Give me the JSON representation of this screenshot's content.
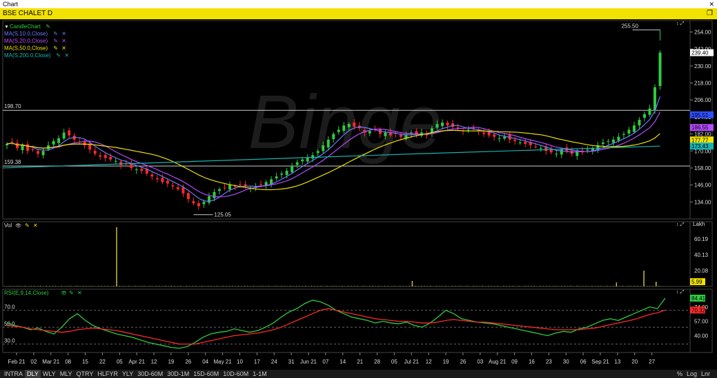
{
  "window": {
    "title": "Chart",
    "close_icon": "close-icon"
  },
  "symbol": {
    "label": "BSE CHALET D",
    "restore_icon": "restore-icon"
  },
  "legend": [
    {
      "label": "CandleChart",
      "color": "#2ecc40"
    },
    {
      "label": "MA(S,10.0,Close)",
      "color": "#6b7bff"
    },
    {
      "label": "MA(S,20.0,Close)",
      "color": "#b44cff"
    },
    {
      "label": "MA(S,50.0,Close)",
      "color": "#f2e200"
    },
    {
      "label": "MA(S,200.0,Close)",
      "color": "#17b3b3"
    }
  ],
  "vol_legend": "Vol",
  "rsi_legend": "RSI(E,9,14,Close)",
  "price_axis": {
    "ticks": [
      "254.00",
      "242.00",
      "230.00",
      "218.00",
      "206.00",
      "194.00",
      "182.00",
      "170.00",
      "158.00",
      "146.00",
      "134.00"
    ]
  },
  "vol_axis": {
    "unit": "Lakh",
    "ticks": [
      "60.19",
      "40.13",
      "20.08"
    ],
    "last": "5.99"
  },
  "rsi_axis": {
    "ticks": [
      "74.00",
      "57.00",
      "40.00"
    ],
    "left_ticks": [
      "70.0",
      "50.0",
      "30.0"
    ],
    "rsi_value": "84.41",
    "signal_value": "70.32"
  },
  "price_badges": [
    "239.40",
    "195.51",
    "186.55",
    "177.77",
    "173.43"
  ],
  "level_labels": {
    "upper": "198.70",
    "lower": "159.38"
  },
  "annotations": {
    "high": "255.50",
    "low": "125.05"
  },
  "watermark": "Binge",
  "xaxis": [
    {
      "label": "Feb 21"
    },
    {
      "label": "02"
    },
    {
      "label": "Mar 21"
    },
    {
      "label": "08"
    },
    {
      "label": "15"
    },
    {
      "label": "22"
    },
    {
      "label": "05"
    },
    {
      "label": "Apr 21"
    },
    {
      "label": "12"
    },
    {
      "label": "19"
    },
    {
      "label": "26"
    },
    {
      "label": "04"
    },
    {
      "label": "May 21"
    },
    {
      "label": "10"
    },
    {
      "label": "17"
    },
    {
      "label": "24"
    },
    {
      "label": "31"
    },
    {
      "label": "Jun 21"
    },
    {
      "label": "07"
    },
    {
      "label": "14"
    },
    {
      "label": "21"
    },
    {
      "label": "28"
    },
    {
      "label": "05"
    },
    {
      "label": "Jul 21"
    },
    {
      "label": "12"
    },
    {
      "label": "19"
    },
    {
      "label": "26"
    },
    {
      "label": "03"
    },
    {
      "label": "Aug 21"
    },
    {
      "label": "09"
    },
    {
      "label": "16"
    },
    {
      "label": "23"
    },
    {
      "label": "30"
    },
    {
      "label": "06"
    },
    {
      "label": "Sep 21"
    },
    {
      "label": "13"
    },
    {
      "label": "20"
    },
    {
      "label": "27"
    }
  ],
  "bottom_tabs": [
    "INTRA",
    "DLY",
    "WLY",
    "MLY",
    "QTRY",
    "HLFYR",
    "YLY",
    "30D-60M",
    "30D-1M",
    "15D-60M",
    "10D-60M",
    "1-1M"
  ],
  "bottom_selected": "DLY",
  "bottom_right": [
    "%",
    "Log",
    "Lnr"
  ],
  "chart_data": [
    {
      "type": "candlestick",
      "title": "BSE CHALET D",
      "ylim": [
        122,
        262
      ],
      "horizontal_lines": [
        198.7,
        159.38
      ],
      "closes": [
        175,
        176,
        172,
        174,
        170,
        171,
        168,
        170,
        174,
        177,
        179,
        183,
        181,
        178,
        176,
        174,
        171,
        168,
        166,
        165,
        164,
        163,
        160,
        161,
        158,
        157,
        156,
        154,
        152,
        150,
        148,
        147,
        145,
        143,
        140,
        136,
        133,
        131,
        134,
        138,
        141,
        143,
        144,
        146,
        145,
        146,
        145,
        144,
        145,
        146,
        148,
        150,
        152,
        154,
        156,
        159,
        162,
        164,
        165,
        167,
        170,
        174,
        178,
        182,
        185,
        188,
        189,
        187,
        186,
        183,
        184,
        185,
        182,
        183,
        181,
        182,
        180,
        181,
        183,
        182,
        183,
        181,
        186,
        189,
        190,
        188,
        187,
        186,
        184,
        185,
        186,
        184,
        182,
        181,
        180,
        179,
        180,
        178,
        177,
        176,
        175,
        174,
        173,
        172,
        170,
        169,
        168,
        171,
        170,
        168,
        170,
        169,
        171,
        172,
        174,
        176,
        177,
        178,
        180,
        182,
        185,
        188,
        192,
        196,
        200,
        215,
        239.4
      ],
      "highs_marked": {
        "high": 255.5,
        "low": 125.05
      },
      "series": [
        {
          "name": "MA(S,10.0,Close)",
          "last": 195.51
        },
        {
          "name": "MA(S,20.0,Close)",
          "last": 186.55
        },
        {
          "name": "MA(S,50.0,Close)",
          "last": 177.77
        },
        {
          "name": "MA(S,200.0,Close)",
          "last": 173.43
        }
      ]
    },
    {
      "type": "bar",
      "title": "Vol",
      "ylabel": "Lakh",
      "spikes": [
        {
          "index": 36,
          "value": 75
        },
        {
          "index": 133,
          "value": 7
        },
        {
          "index": 200,
          "value": 5
        },
        {
          "index": 209,
          "value": 20
        },
        {
          "index": 213,
          "value": 5.99
        }
      ],
      "last": 5.99
    },
    {
      "type": "line",
      "title": "RSI(E,9,14,Close)",
      "ylim": [
        20,
        95
      ],
      "levels": [
        70,
        50,
        30
      ],
      "series": [
        {
          "name": "RSI",
          "values": [
            55,
            52,
            50,
            47,
            49,
            45,
            42,
            50,
            60,
            66,
            58,
            52,
            48,
            45,
            42,
            40,
            38,
            35,
            32,
            30,
            28,
            26,
            25,
            27,
            32,
            38,
            42,
            44,
            45,
            48,
            46,
            44,
            46,
            50,
            55,
            62,
            68,
            72,
            78,
            82,
            80,
            76,
            70,
            66,
            62,
            60,
            58,
            55,
            57,
            55,
            54,
            56,
            52,
            50,
            55,
            62,
            70,
            66,
            60,
            58,
            56,
            55,
            54,
            52,
            50,
            48,
            46,
            44,
            42,
            40,
            43,
            45,
            44,
            48,
            50,
            54,
            58,
            60,
            58,
            62,
            66,
            70,
            74,
            72,
            84.41
          ]
        },
        {
          "name": "Signal",
          "values": [
            52,
            51,
            50,
            48,
            47,
            46,
            45,
            44,
            45,
            47,
            48,
            49,
            48,
            47,
            46,
            44,
            42,
            40,
            38,
            36,
            34,
            32,
            30,
            30,
            30,
            32,
            34,
            36,
            38,
            40,
            41,
            42,
            43,
            45,
            47,
            50,
            54,
            58,
            62,
            66,
            70,
            72,
            70,
            68,
            66,
            64,
            62,
            60,
            59,
            58,
            57,
            57,
            56,
            55,
            55,
            56,
            58,
            59,
            58,
            57,
            56,
            56,
            55,
            54,
            53,
            52,
            51,
            50,
            49,
            48,
            47,
            47,
            47,
            47,
            48,
            49,
            51,
            53,
            55,
            57,
            59,
            62,
            65,
            67,
            70.32
          ]
        }
      ]
    }
  ]
}
